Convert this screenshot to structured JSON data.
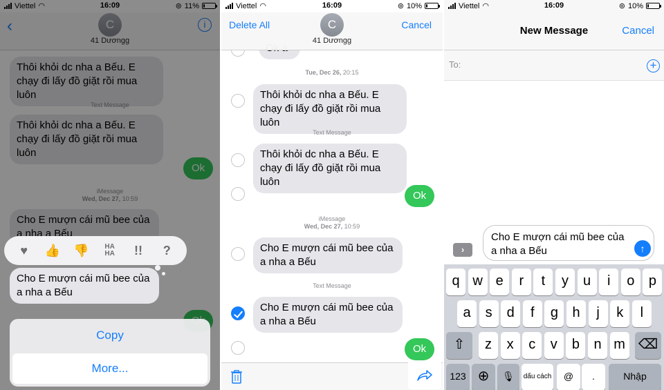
{
  "status": {
    "p1": {
      "carrier": "Viettel",
      "time": "16:09",
      "battery": "11%",
      "battery_level": 0.11
    },
    "p2": {
      "carrier": "Viettel",
      "time": "16:09",
      "battery": "10%",
      "battery_level": 0.1
    },
    "p3": {
      "carrier": "Viettel",
      "time": "16:09",
      "battery": "10%",
      "battery_level": 0.1
    }
  },
  "contact": {
    "initial": "C",
    "name": "41 Dương​g"
  },
  "panel1": {
    "messages": [
      "Thôi khỏi dc nha a Bếu. E chạy đi lấy đồ giặt rồi mua luôn",
      "Thôi khỏi dc nha a Bếu. E chạy đi lấy đồ giặt rồi mua luôn",
      "Ok",
      "Cho E mượn cái mũ bee của a nha a Bếu",
      "Cho E mượn cái mũ bee của a nha a Bếu",
      "Ok"
    ],
    "meta": {
      "text_message": "Text Message",
      "imessage": "iMessage",
      "date": "Wed, Dec 27,",
      "time": "10:59"
    },
    "tapback": [
      "♥",
      "👍",
      "👎",
      "HA HA",
      "!!",
      "?"
    ],
    "actions": {
      "copy": "Copy",
      "more": "More..."
    }
  },
  "panel2": {
    "header": {
      "delete_all": "Delete All",
      "cancel": "Cancel"
    },
    "partial_message": "Ok a",
    "meta": {
      "date1": "Tue, Dec 26,",
      "time1": "20:15",
      "text_message": "Text Message",
      "imessage": "iMessage",
      "date2": "Wed, Dec 27,",
      "time2": "10:59",
      "text_message2": "Text Message"
    },
    "messages": [
      "Thôi khỏi dc nha a Bếu. E chạy đi lấy đồ giặt rồi mua luôn",
      "Thôi khỏi dc nha a Bếu. E chạy đi lấy đồ giặt rồi mua luôn",
      "Ok",
      "Cho E mượn cái mũ bee của a nha a Bếu",
      "Cho E mượn cái mũ bee của a nha a Bếu",
      "Ok"
    ]
  },
  "panel3": {
    "title": "New Message",
    "cancel": "Cancel",
    "to_label": "To:",
    "compose_text": "Cho E mượn cái mũ bee của a nha a Bếu",
    "keys_row1": [
      "q",
      "w",
      "e",
      "r",
      "t",
      "y",
      "u",
      "i",
      "o",
      "p"
    ],
    "keys_row2": [
      "a",
      "s",
      "d",
      "f",
      "g",
      "h",
      "j",
      "k",
      "l"
    ],
    "keys_row3": [
      "z",
      "x",
      "c",
      "v",
      "b",
      "n",
      "m"
    ],
    "key_123": "123",
    "key_space": "dấu cách",
    "key_at": "@",
    "key_dot": ".",
    "key_return": "Nhập"
  },
  "colors": {
    "accent": "#147efb",
    "imessage_green": "#34c759",
    "bubble_gray": "#e5e5ea"
  }
}
